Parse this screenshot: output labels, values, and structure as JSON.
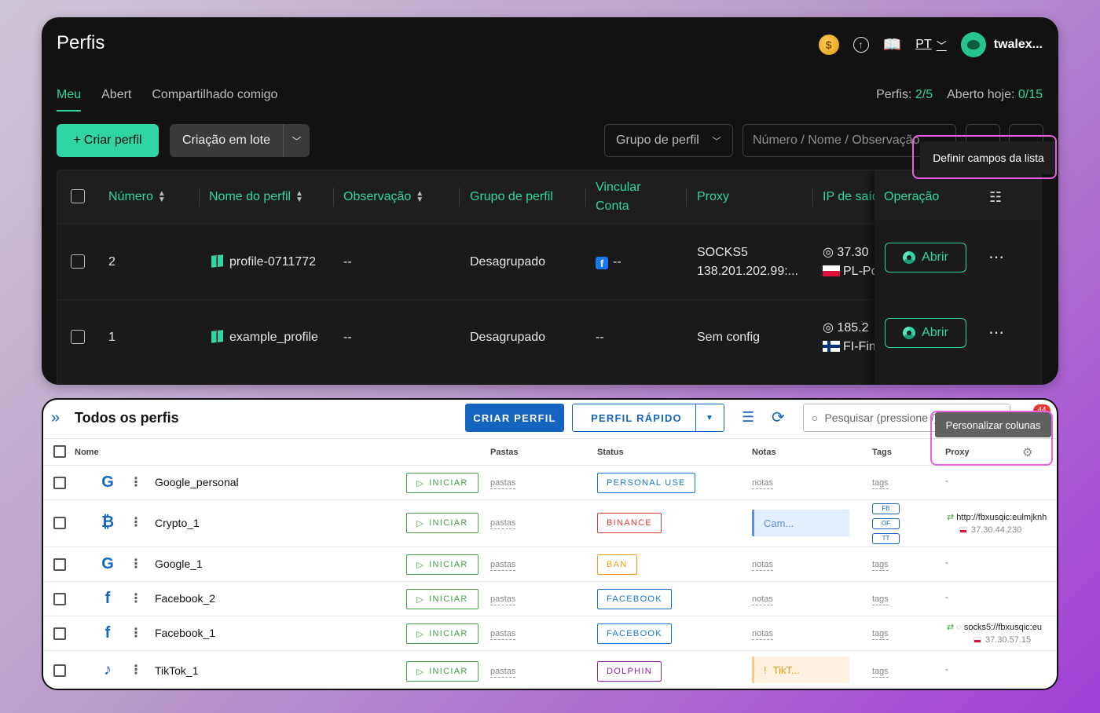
{
  "top": {
    "title": "Perfis",
    "lang": "PT",
    "user": "twalex...",
    "tabs": [
      "Meu",
      "Abert",
      "Compartilhado comigo"
    ],
    "stats": {
      "profiles_label": "Perfis:",
      "profiles_value": "2/5",
      "open_label": "Aberto hoje:",
      "open_value": "0/15"
    },
    "create_button": "Criar perfil",
    "batch_button": "Criação em lote",
    "group_select": "Grupo de perfil",
    "search_placeholder": "Número / Nome / Observação",
    "tooltip": "Definir campos da lista",
    "columns": {
      "number": "Número",
      "name": "Nome do perfil",
      "note": "Observação",
      "group": "Grupo de perfil",
      "link_line1": "Vincular",
      "link_line2": "Conta",
      "proxy": "Proxy",
      "ip": "IP de saída",
      "operation": "Operação"
    },
    "rows": [
      {
        "number": "2",
        "name": "profile-0711772",
        "note": "--",
        "group": "Desagrupado",
        "link": "--",
        "proxy_line1": "SOCKS5",
        "proxy_line2": "138.201.202.99:...",
        "ip": "37.30",
        "country": "PL-Po",
        "open": "Abrir"
      },
      {
        "number": "1",
        "name": "example_profile",
        "note": "--",
        "group": "Desagrupado",
        "link": "--",
        "proxy_line1": "Sem config",
        "proxy_line2": "",
        "ip": "185.2",
        "country": "FI-Fin",
        "open": "Abrir"
      }
    ]
  },
  "bottom": {
    "title": "Todos os perfis",
    "create_button": "CRIAR PERFIL",
    "quick_button": "PERFIL RÁPIDO",
    "search_placeholder": "Pesquisar (pressione /)",
    "notif_count": "44",
    "tooltip": "Personalizar colunas",
    "columns": {
      "name": "Nome",
      "folders": "Pastas",
      "status": "Status",
      "notes": "Notas",
      "tags": "Tags",
      "proxy": "Proxy"
    },
    "start_label": "INICIAR",
    "rows": [
      {
        "icon": "G",
        "name": "Google_personal",
        "folders": "pastas",
        "status": "PERSONAL USE",
        "status_color": "#1976d2",
        "notes": "notas",
        "tags": "tags",
        "proxy": "-"
      },
      {
        "icon": "₿",
        "name": "Crypto_1",
        "folders": "pastas",
        "status": "BINANCE",
        "status_color": "#e53935",
        "notes": "Cam...",
        "tags": "",
        "tag_list": [
          "FB",
          "OF",
          "TT"
        ],
        "proxy_url": "http://fbxusqic:eulmjknh",
        "proxy_ip": "37.30.44.230"
      },
      {
        "icon": "G",
        "name": "Google_1",
        "folders": "pastas",
        "status": "BAN",
        "status_color": "#f39c12",
        "notes": "notas",
        "tags": "tags",
        "proxy": "-"
      },
      {
        "icon": "f",
        "name": "Facebook_2",
        "folders": "pastas",
        "status": "FACEBOOK",
        "status_color": "#1976d2",
        "notes": "notas",
        "tags": "tags",
        "proxy": "-"
      },
      {
        "icon": "f",
        "name": "Facebook_1",
        "folders": "pastas",
        "status": "FACEBOOK",
        "status_color": "#1976d2",
        "notes": "notas",
        "tags": "tags",
        "proxy_url": "socks5://fbxusqic:eu",
        "proxy_ip": "37.30.57.15"
      },
      {
        "icon": "♪",
        "name": "TikTok_1",
        "folders": "pastas",
        "status": "DOLPHIN",
        "status_color": "#8e24aa",
        "notes": "TikT...",
        "tags": "tags",
        "proxy": "-"
      }
    ]
  },
  "colors": {
    "accent_green": "#2fd6a3",
    "accent_blue": "#1565c0",
    "highlight": "#ec5fe0"
  }
}
